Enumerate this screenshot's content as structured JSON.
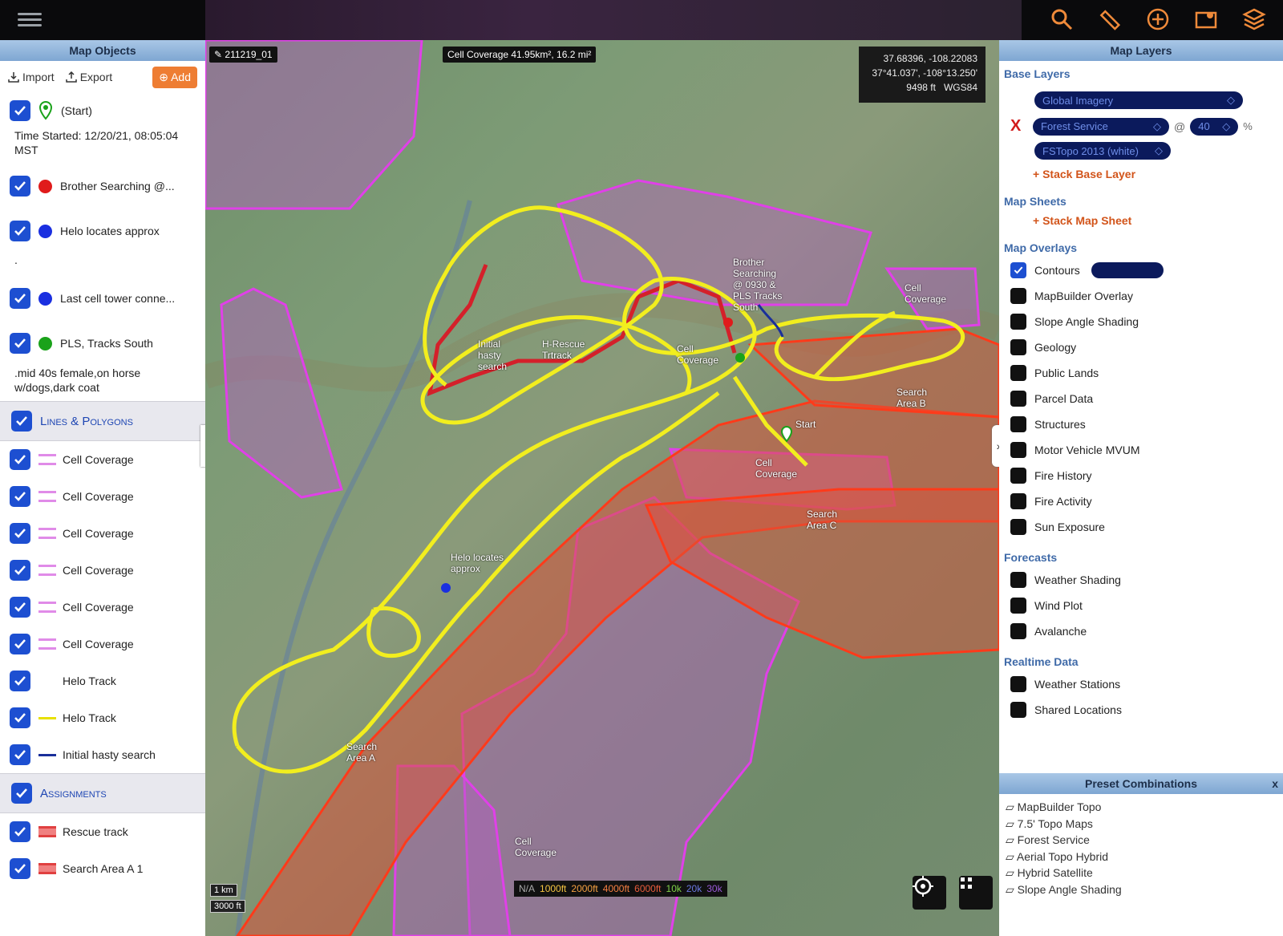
{
  "left_panel": {
    "title": "Map Objects",
    "toolbar": {
      "import": "Import",
      "export": "Export",
      "add": "Add"
    },
    "objects": [
      {
        "label": "(Start)",
        "marker": "green-pin"
      },
      {
        "label": "Brother Searching @...",
        "color": "#e01b1b"
      },
      {
        "label": "Helo locates approx",
        "color": "#1a2fe0"
      },
      {
        "label": "Last cell tower conne...",
        "color": "#1a2fe0"
      },
      {
        "label": "PLS, Tracks South",
        "color": "#1aa21a"
      }
    ],
    "start_note": "Time Started: 12/20/21, 08:05:04 MST",
    "helo_note": ".",
    "pls_note": ".mid 40s female,on horse w/dogs,dark coat",
    "lines_section": "Lines & Polygons",
    "lines": [
      {
        "label": "Cell Coverage",
        "color": "#e08be8"
      },
      {
        "label": "Cell Coverage",
        "color": "#e08be8"
      },
      {
        "label": "Cell Coverage",
        "color": "#e08be8"
      },
      {
        "label": "Cell Coverage",
        "color": "#e08be8"
      },
      {
        "label": "Cell Coverage",
        "color": "#e08be8"
      },
      {
        "label": "Cell Coverage",
        "color": "#e08be8"
      },
      {
        "label": "Helo Track",
        "color": ""
      },
      {
        "label": "Helo Track",
        "color": "#e8e000"
      },
      {
        "label": "Initial hasty search",
        "color": "#1a2f9a"
      }
    ],
    "assignments_section": "Assignments",
    "assignments": [
      {
        "label": "Rescue track",
        "color": "#f08080"
      },
      {
        "label": "Search Area A 1",
        "color": "#f08080"
      }
    ]
  },
  "map": {
    "map_name": "211219_01",
    "measure": "Cell Coverage 41.95km², 16.2 mi²",
    "coords": {
      "decimal": "37.68396, -108.22083",
      "dms": "37°41.037', -108°13.250'",
      "elev": "9498 ft",
      "datum": "WGS84"
    },
    "scale_km": "1 km",
    "scale_ft": "3000 ft",
    "elevation_legend": [
      "N/A",
      "1000ft",
      "2000ft",
      "4000ft",
      "6000ft",
      "10k",
      "20k",
      "30k"
    ],
    "labels": {
      "initial": "Initial hasty search",
      "rescue": "H-Rescue Trtrack",
      "brother": "Brother Searching @ 0930 & PLS Tracks South",
      "cell1": "Cell Coverage",
      "cell2": "Cell Coverage",
      "cell3": "Cell Coverage",
      "cell4": "Cell Coverage",
      "search_b": "Search Area B",
      "search_c": "Search Area C",
      "search_a": "Search Area A",
      "start": "Start",
      "helo": "Helo locates approx"
    }
  },
  "right_panel": {
    "title": "Map Layers",
    "base_layers": "Base Layers",
    "base_layer": "Global Imagery",
    "stack_layer": "Forest Service",
    "stack_sub": "FSTopo 2013 (white)",
    "opacity": "40",
    "at": "@",
    "pct": "%",
    "remove": "X",
    "stack_base": "+ Stack Base Layer",
    "map_sheets": "Map Sheets",
    "stack_sheet": "+ Stack Map Sheet",
    "map_overlays": "Map Overlays",
    "overlays": [
      {
        "label": "Contours",
        "on": true
      },
      {
        "label": "MapBuilder Overlay",
        "on": false
      },
      {
        "label": "Slope Angle Shading",
        "on": false
      },
      {
        "label": "Geology",
        "on": false
      },
      {
        "label": "Public Lands",
        "on": false
      },
      {
        "label": "Parcel Data",
        "on": false
      },
      {
        "label": "Structures",
        "on": false
      },
      {
        "label": "Motor Vehicle MVUM",
        "on": false
      },
      {
        "label": "Fire History",
        "on": false
      },
      {
        "label": "Fire Activity",
        "on": false
      },
      {
        "label": "Sun Exposure",
        "on": false
      }
    ],
    "forecasts": "Forecasts",
    "forecast_items": [
      "Weather Shading",
      "Wind Plot",
      "Avalanche"
    ],
    "realtime": "Realtime Data",
    "realtime_items": [
      "Weather Stations",
      "Shared Locations"
    ],
    "preset_title": "Preset Combinations",
    "preset_close": "x",
    "presets": [
      "MapBuilder Topo",
      "7.5' Topo Maps",
      "Forest Service",
      "Aerial Topo Hybrid",
      "Hybrid Satellite",
      "Slope Angle Shading"
    ]
  }
}
